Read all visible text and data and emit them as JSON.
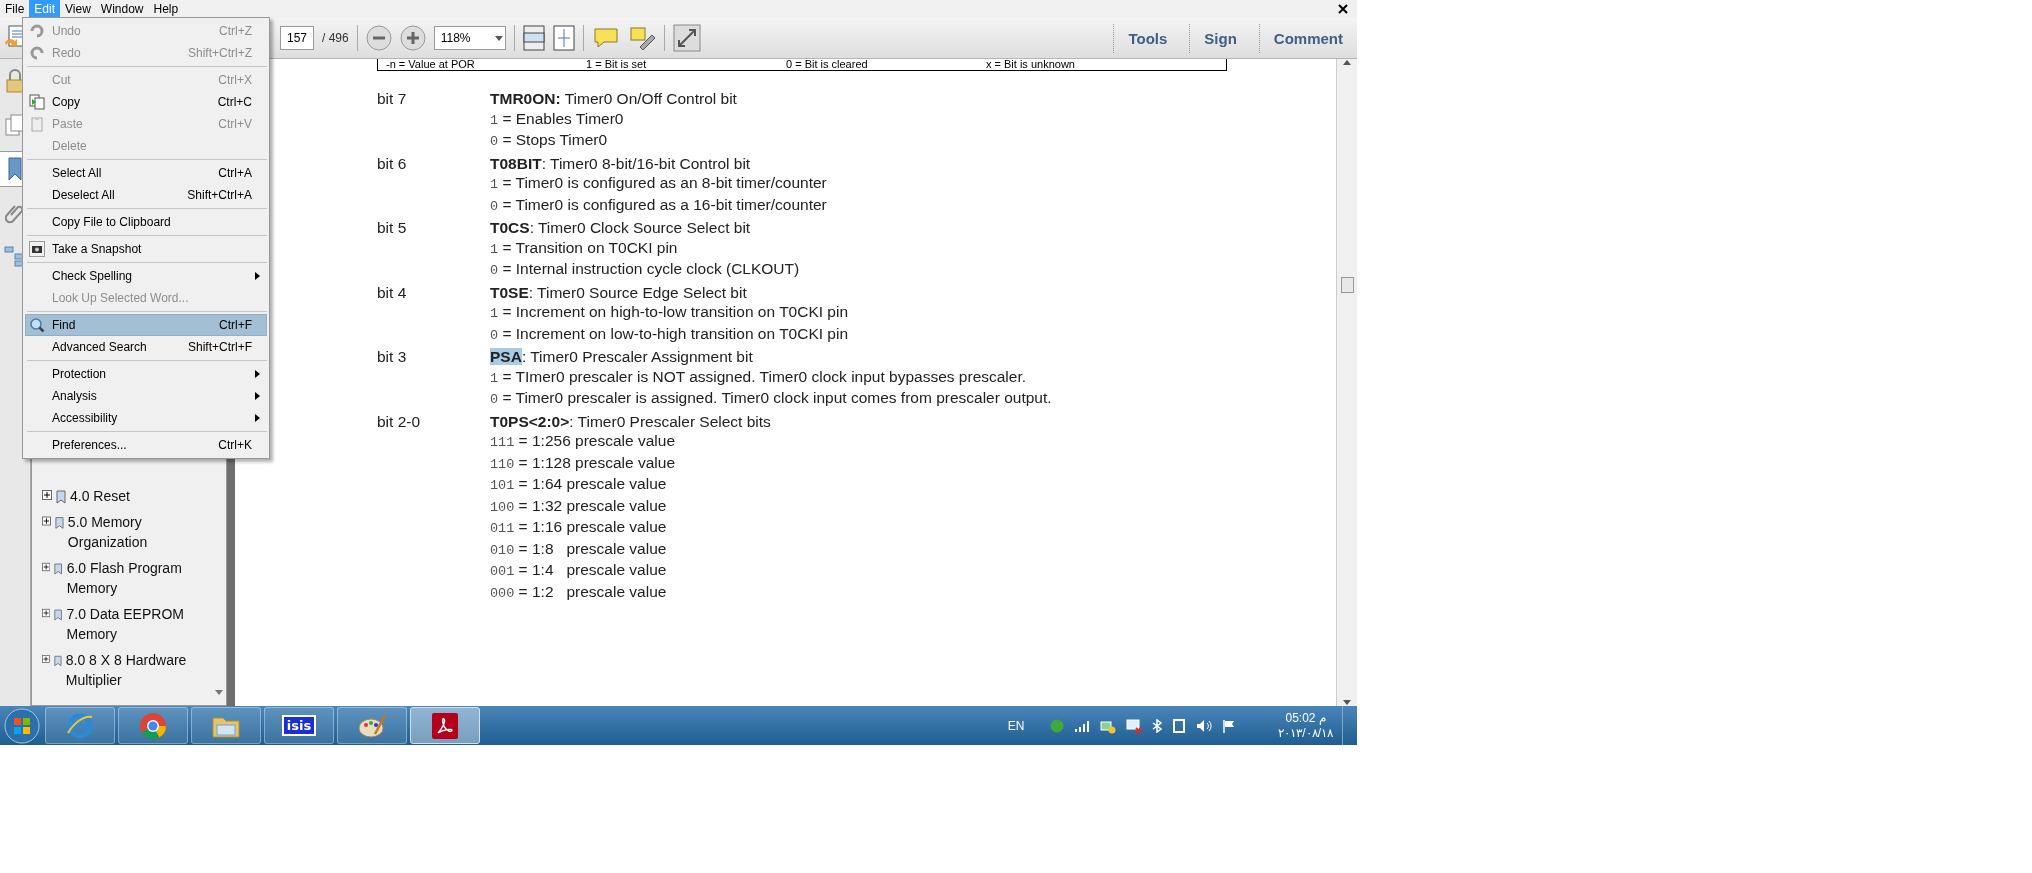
{
  "menu_bar": [
    {
      "label": "File",
      "selected": false
    },
    {
      "label": "Edit",
      "selected": true
    },
    {
      "label": "View",
      "selected": false
    },
    {
      "label": "Window",
      "selected": false
    },
    {
      "label": "Help",
      "selected": false
    }
  ],
  "edit_menu": [
    {
      "kind": "item",
      "label": "Undo",
      "shortcut": "Ctrl+Z",
      "disabled": true,
      "selected": false,
      "submenu": false
    },
    {
      "kind": "item",
      "label": "Redo",
      "shortcut": "Shift+Ctrl+Z",
      "disabled": true,
      "selected": false,
      "submenu": false
    },
    {
      "kind": "separator"
    },
    {
      "kind": "item",
      "label": "Cut",
      "shortcut": "Ctrl+X",
      "disabled": true,
      "selected": false,
      "submenu": false
    },
    {
      "kind": "item",
      "label": "Copy",
      "shortcut": "Ctrl+C",
      "disabled": false,
      "selected": false,
      "submenu": false
    },
    {
      "kind": "item",
      "label": "Paste",
      "shortcut": "Ctrl+V",
      "disabled": true,
      "selected": false,
      "submenu": false
    },
    {
      "kind": "item",
      "label": "Delete",
      "disabled": true,
      "selected": false,
      "submenu": false
    },
    {
      "kind": "separator"
    },
    {
      "kind": "item",
      "label": "Select All",
      "shortcut": "Ctrl+A",
      "disabled": false,
      "selected": false,
      "submenu": false
    },
    {
      "kind": "item",
      "label": "Deselect All",
      "shortcut": "Shift+Ctrl+A",
      "disabled": false,
      "selected": false,
      "submenu": false
    },
    {
      "kind": "separator"
    },
    {
      "kind": "item",
      "label": "Copy File to Clipboard",
      "disabled": false,
      "selected": false,
      "submenu": false
    },
    {
      "kind": "separator"
    },
    {
      "kind": "item",
      "label": "Take a Snapshot",
      "disabled": false,
      "selected": false,
      "submenu": false
    },
    {
      "kind": "separator"
    },
    {
      "kind": "item",
      "label": "Check Spelling",
      "disabled": false,
      "selected": false,
      "submenu": true
    },
    {
      "kind": "item",
      "label": "Look Up Selected Word...",
      "disabled": true,
      "selected": false,
      "submenu": false
    },
    {
      "kind": "separator"
    },
    {
      "kind": "item",
      "label": "Find",
      "shortcut": "Ctrl+F",
      "disabled": false,
      "selected": true,
      "submenu": false
    },
    {
      "kind": "item",
      "label": "Advanced Search",
      "shortcut": "Shift+Ctrl+F",
      "disabled": false,
      "selected": false,
      "submenu": false
    },
    {
      "kind": "separator"
    },
    {
      "kind": "item",
      "label": "Protection",
      "disabled": false,
      "selected": false,
      "submenu": true
    },
    {
      "kind": "item",
      "label": "Analysis",
      "disabled": false,
      "selected": false,
      "submenu": true
    },
    {
      "kind": "item",
      "label": "Accessibility",
      "disabled": false,
      "selected": false,
      "submenu": true
    },
    {
      "kind": "separator"
    },
    {
      "kind": "item",
      "label": "Preferences...",
      "shortcut": "Ctrl+K",
      "disabled": false,
      "selected": false,
      "submenu": false
    }
  ],
  "toolbar": {
    "page": "157",
    "page_count": "/ 496",
    "zoom": "118%",
    "right_buttons": [
      "Tools",
      "Sign",
      "Comment"
    ]
  },
  "nav_buttons": [
    {
      "selected": false
    },
    {
      "selected": false
    },
    {
      "selected": true
    },
    {
      "selected": false
    },
    {
      "selected": false
    }
  ],
  "bookmarks": [
    {
      "label": "4.0 Reset",
      "expanded": false
    },
    {
      "label": "5.0 Memory Organization",
      "expanded": false
    },
    {
      "label": "6.0 Flash Program Memory",
      "expanded": false
    },
    {
      "label": "7.0 Data EEPROM Memory",
      "expanded": false
    },
    {
      "label": "8.0 8 X 8 Hardware Multiplier",
      "expanded": false
    }
  ],
  "document": {
    "legend": [
      "-n = Value at POR",
      "1 = Bit is set",
      "0 = Bit is cleared",
      "x = Bit is unknown"
    ],
    "bits": [
      {
        "bit": "bit 7",
        "name": "TMR0ON:",
        "title": " Timer0 On/Off Control bit",
        "selected": false,
        "values": [
          {
            "code": "1",
            "text": " = Enables Timer0"
          },
          {
            "code": "0",
            "text": " = Stops Timer0"
          }
        ]
      },
      {
        "bit": "bit 6",
        "name": "T08BIT",
        "title": ": Timer0 8-bit/16-bit Control bit",
        "selected": false,
        "values": [
          {
            "code": "1",
            "text": " = Timer0 is configured as an 8-bit timer/counter"
          },
          {
            "code": "0",
            "text": " = Timer0 is configured as a 16-bit timer/counter"
          }
        ]
      },
      {
        "bit": "bit 5",
        "name": "T0CS",
        "title": ": Timer0 Clock Source Select bit",
        "selected": false,
        "values": [
          {
            "code": "1",
            "text": " = Transition on T0CKI pin"
          },
          {
            "code": "0",
            "text": " = Internal instruction cycle clock (CLKOUT)"
          }
        ]
      },
      {
        "bit": "bit 4",
        "name": "T0SE",
        "title": ": Timer0 Source Edge Select bit",
        "selected": false,
        "values": [
          {
            "code": "1",
            "text": " = Increment on high-to-low transition on T0CKI pin"
          },
          {
            "code": "0",
            "text": " = Increment on low-to-high transition on T0CKI pin"
          }
        ]
      },
      {
        "bit": "bit 3",
        "name": "PSA",
        "title": ": Timer0 Prescaler Assignment bit",
        "selected": true,
        "values": [
          {
            "code": "1",
            "text": " = TImer0 prescaler is NOT assigned. Timer0 clock input bypasses prescaler."
          },
          {
            "code": "0",
            "text": " = Timer0 prescaler is assigned. Timer0 clock input comes from prescaler output."
          }
        ]
      },
      {
        "bit": "bit 2-0",
        "name": "T0PS<2:0>",
        "title": ": Timer0 Prescaler Select bits",
        "selected": false,
        "values": [
          {
            "code": "111",
            "text": " = 1:256 prescale value"
          },
          {
            "code": "110",
            "text": " = 1:128 prescale value"
          },
          {
            "code": "101",
            "text": " = 1:64 prescale value"
          },
          {
            "code": "100",
            "text": " = 1:32 prescale value"
          },
          {
            "code": "011",
            "text": " = 1:16 prescale value"
          },
          {
            "code": "010",
            "text": " = 1:8   prescale value"
          },
          {
            "code": "001",
            "text": " = 1:4   prescale value"
          },
          {
            "code": "000",
            "text": " = 1:2   prescale value"
          }
        ]
      }
    ]
  },
  "taskbar": {
    "apps": [
      {
        "selected": false
      },
      {
        "selected": false
      },
      {
        "selected": false
      },
      {
        "label": "isis",
        "selected": false
      },
      {
        "selected": false
      },
      {
        "selected": true
      }
    ],
    "language": "EN",
    "time": "05:02 م",
    "date": "٢٠١٣/٠٨/١٨"
  }
}
